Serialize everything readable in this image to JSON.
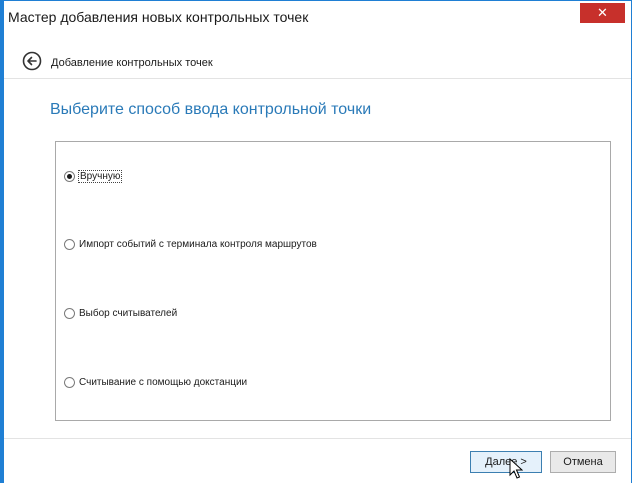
{
  "window": {
    "title": "Мастер добавления новых контрольных точек",
    "close_glyph": "✕"
  },
  "nav": {
    "back_icon": "back-arrow-circle-icon",
    "title": "Добавление контрольных точек"
  },
  "heading": "Выберите способ ввода контрольной точки",
  "options": [
    {
      "label": "Вручную",
      "selected": true
    },
    {
      "label": "Импорт событий с терминала контроля маршрутов",
      "selected": false
    },
    {
      "label": "Выбор считывателей",
      "selected": false
    },
    {
      "label": "Считывание с помощью докстанции",
      "selected": false
    }
  ],
  "buttons": {
    "next": "Далее >",
    "cancel": "Отмена"
  },
  "colors": {
    "accent": "#1f7fd4",
    "heading": "#2a7ab8",
    "close": "#c7302b"
  }
}
